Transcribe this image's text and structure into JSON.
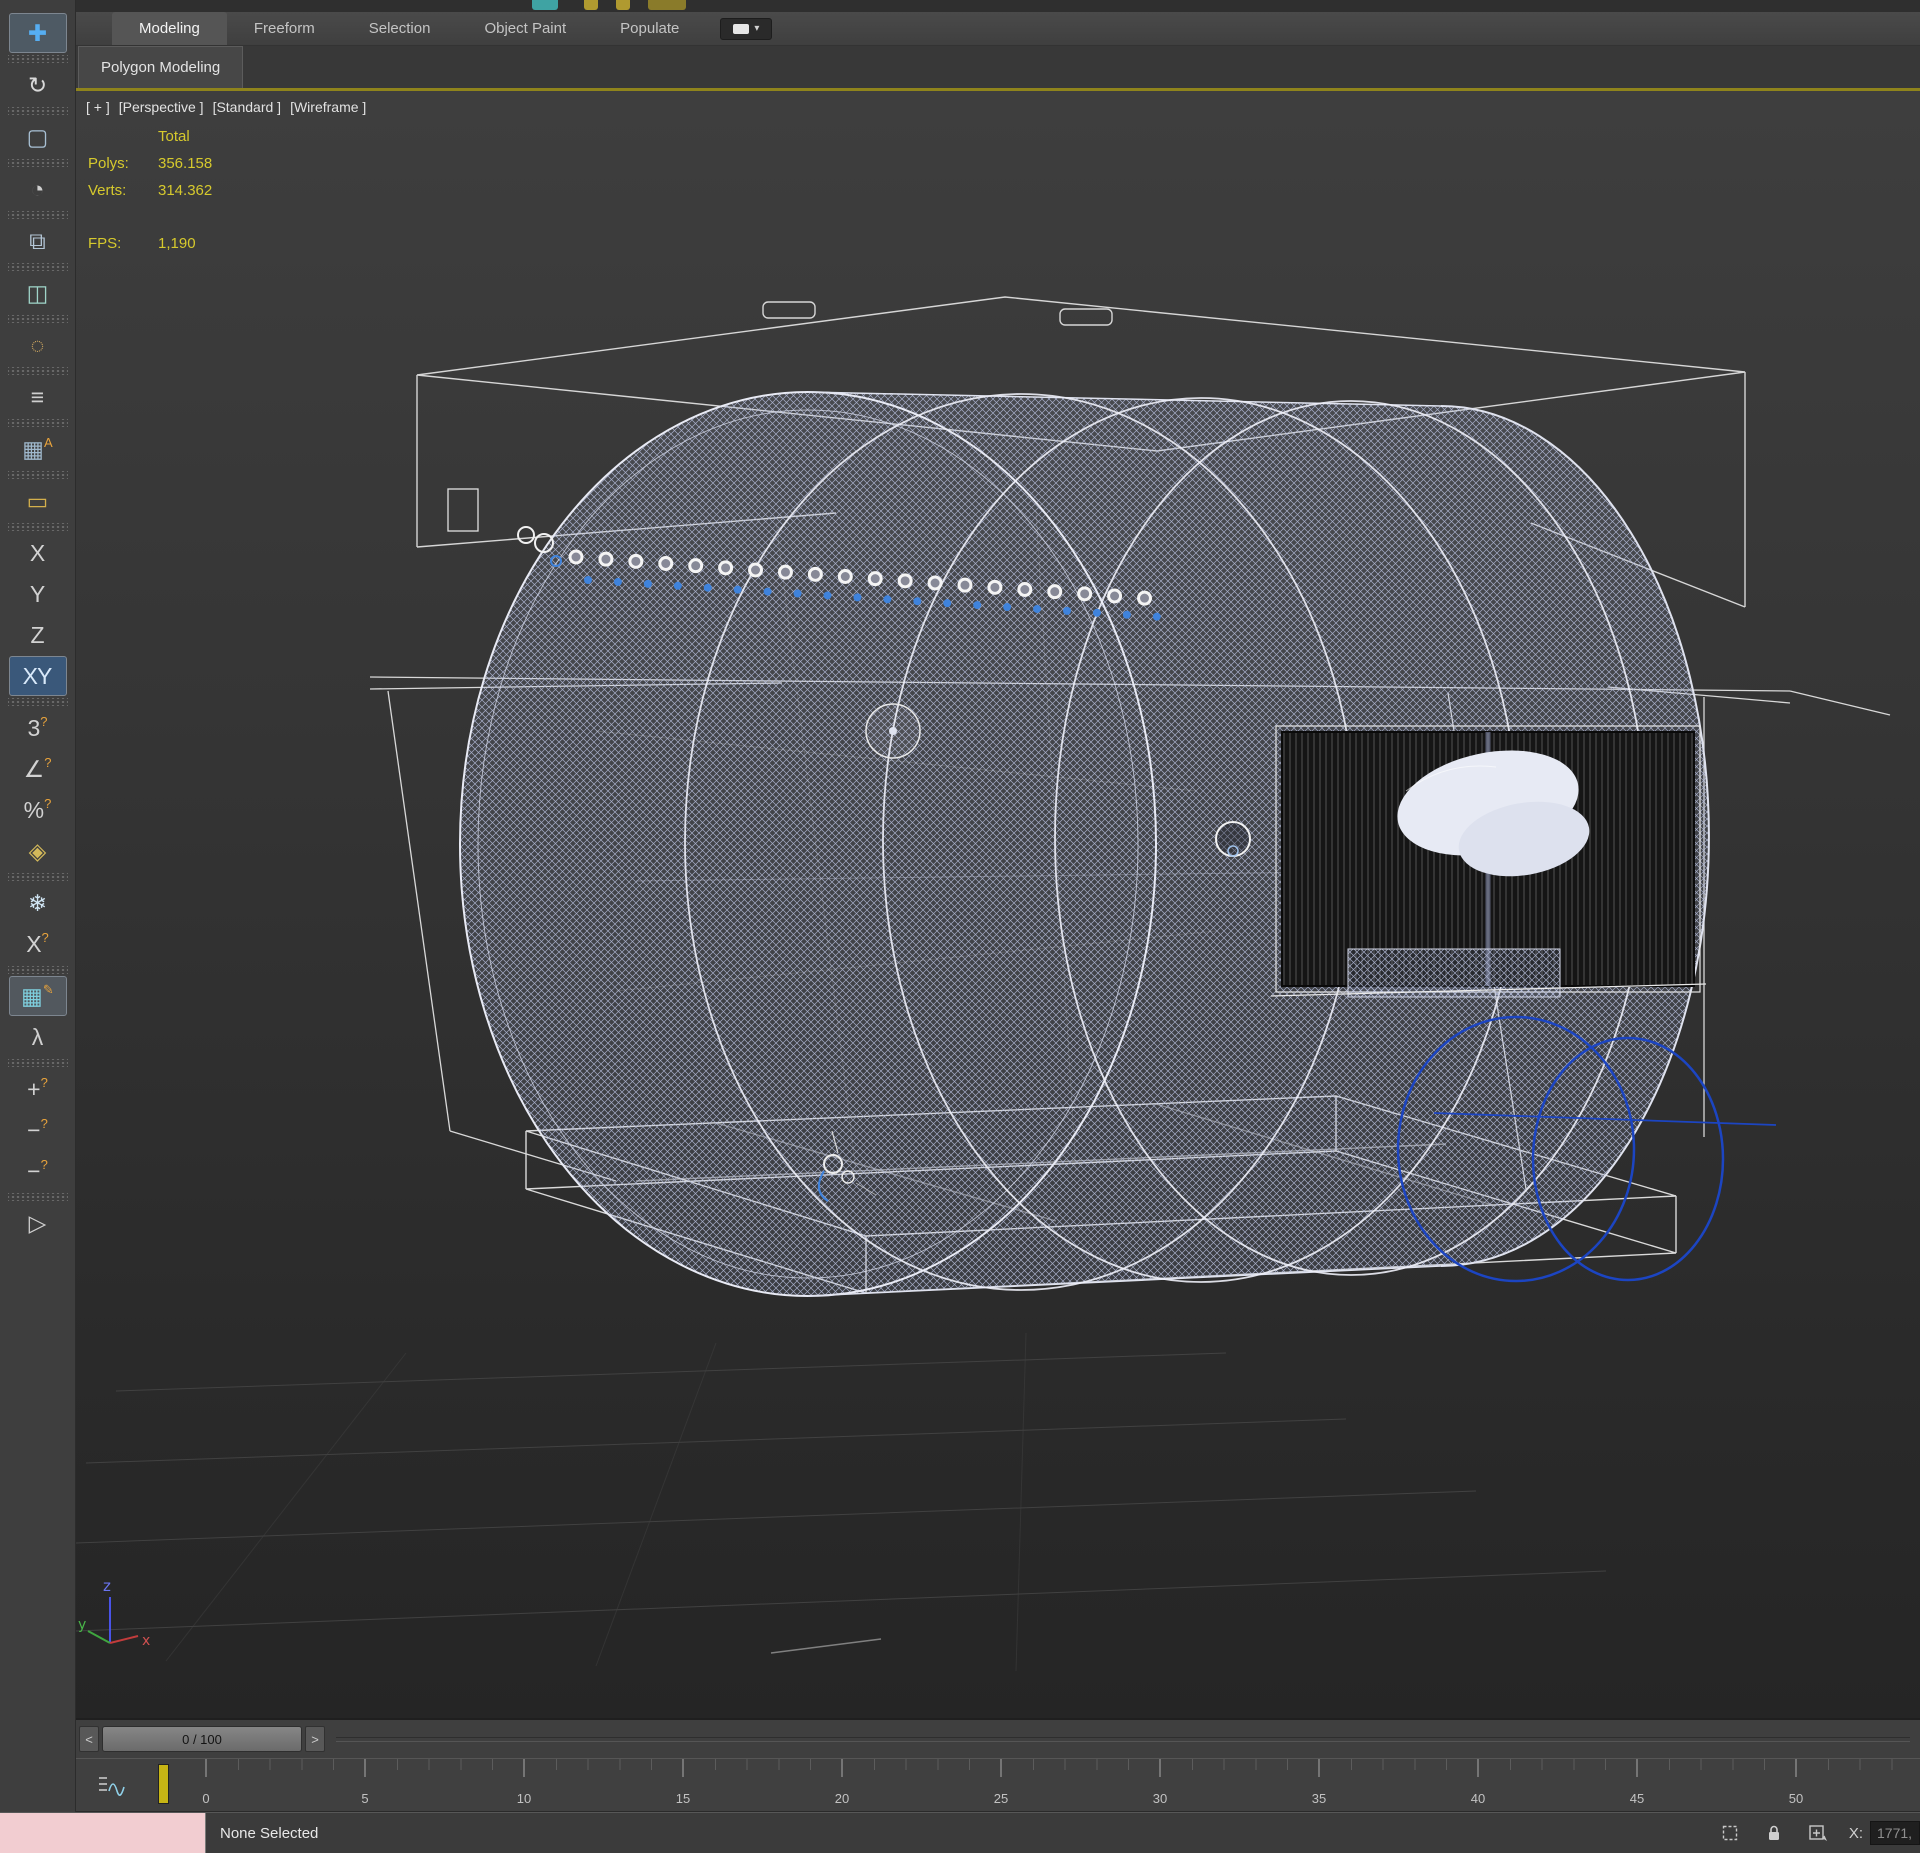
{
  "ribbon": {
    "tabs": [
      {
        "name": "tab-modeling",
        "label": "Modeling",
        "active": true
      },
      {
        "name": "tab-freeform",
        "label": "Freeform"
      },
      {
        "name": "tab-selection",
        "label": "Selection"
      },
      {
        "name": "tab-object-paint",
        "label": "Object Paint"
      },
      {
        "name": "tab-populate",
        "label": "Populate"
      }
    ],
    "overflow_caret": "▾",
    "panel_tab": "Polygon Modeling"
  },
  "toolbar": {
    "tools": [
      {
        "name": "tool-select-and-move",
        "glyph": "✚",
        "color": "#56aef2",
        "active": true,
        "bg": "#4e5a64"
      },
      {
        "sep": true
      },
      {
        "name": "tool-rotate",
        "glyph": "↻",
        "color": "#d8d8d8"
      },
      {
        "sep": true
      },
      {
        "name": "tool-rectangular-selection-region",
        "glyph": "▢",
        "color": "#a8c0d4"
      },
      {
        "sep": true
      },
      {
        "name": "tool-edit-pivot",
        "glyph": "◔",
        "color": "#cfcfcf"
      },
      {
        "sep": true
      },
      {
        "name": "tool-clone",
        "glyph": "⧉",
        "color": "#b4c6d6"
      },
      {
        "sep": true
      },
      {
        "name": "tool-mirror",
        "glyph": "◫",
        "color": "#9fd4c8"
      },
      {
        "sep": true
      },
      {
        "name": "tool-soft-selection",
        "glyph": "◌",
        "color": "#d0a860"
      },
      {
        "sep": true
      },
      {
        "name": "tool-align",
        "glyph": "≡",
        "color": "#cfcfcf"
      },
      {
        "sep": true
      },
      {
        "name": "tool-autogrid",
        "glyph": "▦",
        "accent": "A",
        "color": "#9fb8cc"
      },
      {
        "sep": true
      },
      {
        "name": "tool-measure",
        "glyph": "▭",
        "color": "#d4b04c"
      },
      {
        "sep": true
      },
      {
        "name": "tool-constraint-x",
        "glyph": "X",
        "color": "#d2d2d2"
      },
      {
        "name": "tool-constraint-y",
        "glyph": "Y",
        "color": "#d2d2d2"
      },
      {
        "name": "tool-constraint-z",
        "glyph": "Z",
        "color": "#d2d2d2"
      },
      {
        "name": "tool-constraint-xy",
        "glyph": "XY",
        "color": "#d8e9fa",
        "active": true,
        "bg": "#3a587a"
      },
      {
        "sep": true
      },
      {
        "name": "tool-numeric-snap-3",
        "glyph": "3",
        "accent": "?",
        "color": "#d2d2d2"
      },
      {
        "name": "tool-angle-snap",
        "glyph": "∠",
        "accent": "?",
        "color": "#d2d2d2"
      },
      {
        "name": "tool-percent-snap",
        "glyph": "%",
        "accent": "?",
        "color": "#d2d2d2"
      },
      {
        "name": "tool-swap",
        "glyph": "◈",
        "color": "#d2b85a"
      },
      {
        "sep": true
      },
      {
        "name": "tool-freeze",
        "glyph": "❄",
        "color": "#cfe4f2"
      },
      {
        "name": "tool-x-snap",
        "glyph": "X",
        "accent": "?",
        "color": "#d2d2d2"
      },
      {
        "sep": true
      },
      {
        "name": "tool-grid-edit",
        "glyph": "▦",
        "accent": "✎",
        "color": "#7ecfde",
        "active": true,
        "bg": "#52585e"
      },
      {
        "name": "tool-kinematic-chain",
        "glyph": "λ",
        "color": "#cfcfcf"
      },
      {
        "sep": true
      },
      {
        "name": "tool-add-point",
        "glyph": "+",
        "accent": "?",
        "color": "#d2d2d2"
      },
      {
        "name": "tool-remove-point",
        "glyph": "−",
        "accent": "?",
        "color": "#d2d2d2"
      },
      {
        "name": "tool-remove-point-2",
        "glyph": "−",
        "accent": "?",
        "color": "#d2d2d2"
      },
      {
        "sep": true
      },
      {
        "name": "tool-select-arrow",
        "glyph": "▷",
        "color": "#cfcfcf"
      }
    ]
  },
  "viewport": {
    "label_segments": [
      "[ + ]",
      "[Perspective ]",
      "[Standard ]",
      "[Wireframe ]"
    ],
    "stats": {
      "total_label": "Total",
      "polys_label": "Polys:",
      "polys_value": "356.158",
      "verts_label": "Verts:",
      "verts_value": "314.362",
      "fps_label": "FPS:",
      "fps_value": "1,190"
    },
    "axis": {
      "z": "z",
      "y": "y",
      "x": "x"
    }
  },
  "timeline": {
    "prev": "<",
    "next": ">",
    "frame_display": "0 / 100",
    "ticks": [
      "0",
      "5",
      "10",
      "15",
      "20",
      "25",
      "30",
      "35",
      "40",
      "45",
      "50"
    ]
  },
  "statusbar": {
    "selection": "None Selected",
    "icon_names": [
      "selection-region-icon",
      "selection-lock-icon",
      "transform-typein-icon"
    ],
    "x_label": "X:",
    "x_value": "1771,"
  },
  "colors": {
    "active_viewport_border": "#8f841c",
    "stats_text": "#d6c92d",
    "wireframe": "#e8eaf4",
    "mesh": "#b8c0de",
    "selection_blue": "#1c45c2",
    "gizmo_blue": "#4953e8",
    "gizmo_green": "#3fa63f",
    "gizmo_red": "#c23c3c",
    "listener_pink": "#f2cdd1",
    "frame_marker": "#c7b515"
  }
}
